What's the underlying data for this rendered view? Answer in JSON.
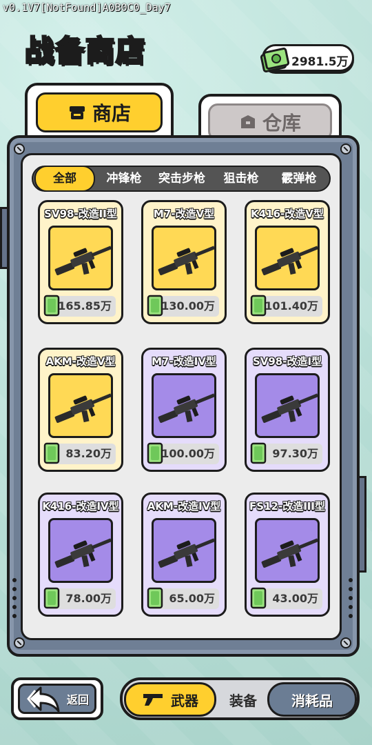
{
  "version": "v0.1V7[NotFound]A0B0C0_Day7",
  "header": {
    "title": "战备商店",
    "currency": "2981.5万"
  },
  "tabs": {
    "shop": "商店",
    "warehouse": "仓库"
  },
  "filters": [
    "全部",
    "冲锋枪",
    "突击步枪",
    "狙击枪",
    "霰弹枪"
  ],
  "filter_active": "全部",
  "items": [
    {
      "name": "SV98-改造II型",
      "price": "165.85万",
      "rarity": "gold"
    },
    {
      "name": "M7-改造V型",
      "price": "130.00万",
      "rarity": "gold"
    },
    {
      "name": "K416-改造V型",
      "price": "101.40万",
      "rarity": "gold"
    },
    {
      "name": "AKM-改造V型",
      "price": "83.20万",
      "rarity": "gold"
    },
    {
      "name": "M7-改造IV型",
      "price": "100.00万",
      "rarity": "purple"
    },
    {
      "name": "SV98-改造I型",
      "price": "97.30万",
      "rarity": "purple"
    },
    {
      "name": "K416-改造IV型",
      "price": "78.00万",
      "rarity": "purple"
    },
    {
      "name": "AKM-改造IV型",
      "price": "65.00万",
      "rarity": "purple"
    },
    {
      "name": "FS12-改造III型",
      "price": "43.00万",
      "rarity": "purple"
    }
  ],
  "bottom": {
    "back": "返回",
    "weapons": "武器",
    "equipment": "装备",
    "consumables": "消耗品"
  },
  "colors": {
    "accent": "#ffcf2e",
    "gold_tile": "#ffd955",
    "purple_tile": "#a48be8",
    "panel": "#6f7f95"
  }
}
